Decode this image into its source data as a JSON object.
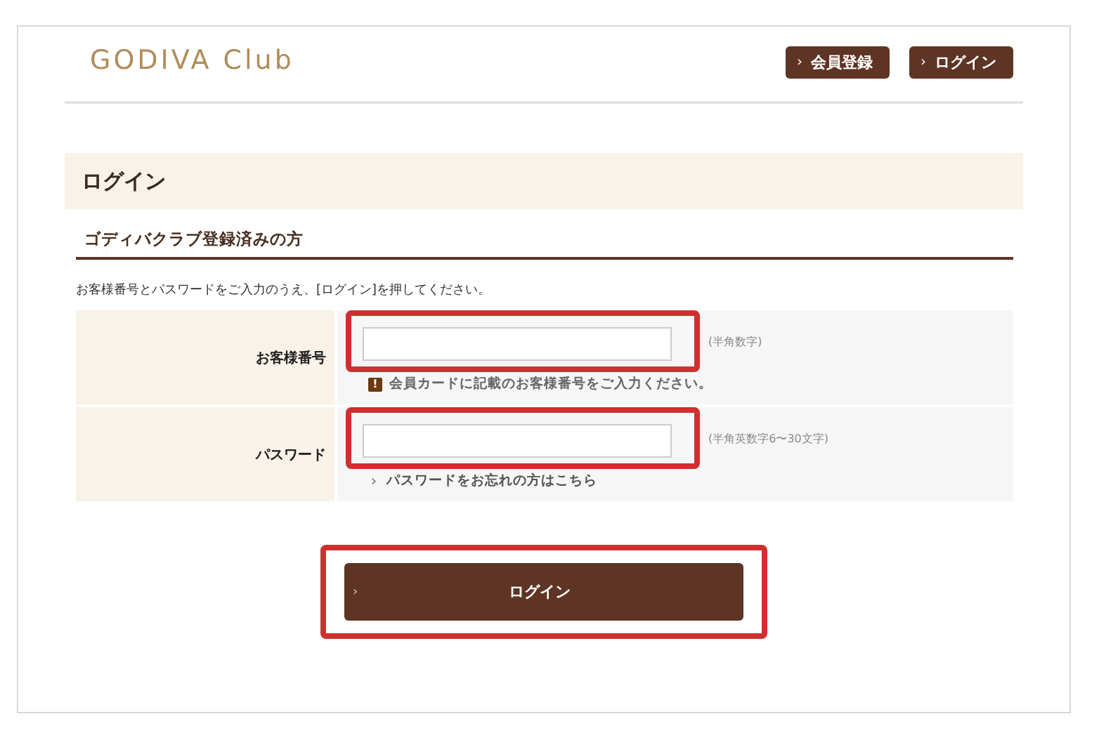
{
  "logo": "GODIVA Club",
  "header_buttons": [
    {
      "icon": "›",
      "label": "会員登録"
    },
    {
      "icon": "›",
      "label": "ログイン"
    }
  ],
  "page_title": "ログイン",
  "section_title": "ゴディバクラブ登録済みの方",
  "instructions": "お客様番号とパスワードをご入力のうえ、[ログイン]を押してください。",
  "fields": [
    {
      "label": "お客様番号",
      "hint": "(半角数字)",
      "highlighted": true,
      "note": {
        "kind": "warning",
        "icon": "!",
        "text": "会員カードに記載のお客様番号をご入力ください。"
      }
    },
    {
      "label": "パスワード",
      "hint": "(半角英数字6〜30文字)",
      "highlighted": true,
      "note": {
        "kind": "link",
        "icon": "›",
        "text": "パスワードをお忘れの方はこちら"
      }
    }
  ],
  "submit": {
    "icon": "›",
    "label": "ログイン",
    "highlighted": true
  }
}
